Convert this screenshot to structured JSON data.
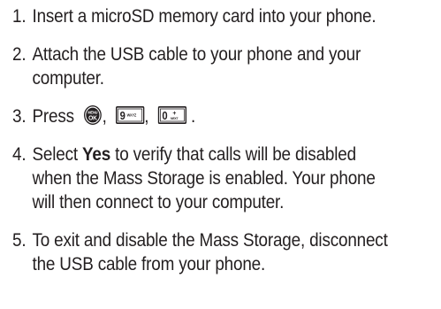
{
  "steps": [
    {
      "number": "1.",
      "text": "Insert a microSD memory card into your phone."
    },
    {
      "number": "2.",
      "text": "Attach the USB cable to your phone and your computer."
    },
    {
      "number": "3.",
      "prefix": "Press",
      "separator": ",",
      "terminator": ".",
      "keys": [
        {
          "icon": "menu-ok-key-icon",
          "line1": "MENU",
          "line2": "OK"
        },
        {
          "icon": "nine-wxyz-key-icon",
          "digit": "9",
          "letters": "WXYZ"
        },
        {
          "icon": "zero-next-key-icon",
          "digit": "0",
          "symbol": "+",
          "letters": "NEXT"
        }
      ]
    },
    {
      "number": "4.",
      "before": "Select ",
      "bold": "Yes",
      "after": " to verify that calls will be disabled when the Mass Storage is enabled. Your phone will then connect to your computer."
    },
    {
      "number": "5.",
      "text": "To exit and disable the Mass Storage, disconnect the USB cable from your phone."
    }
  ]
}
